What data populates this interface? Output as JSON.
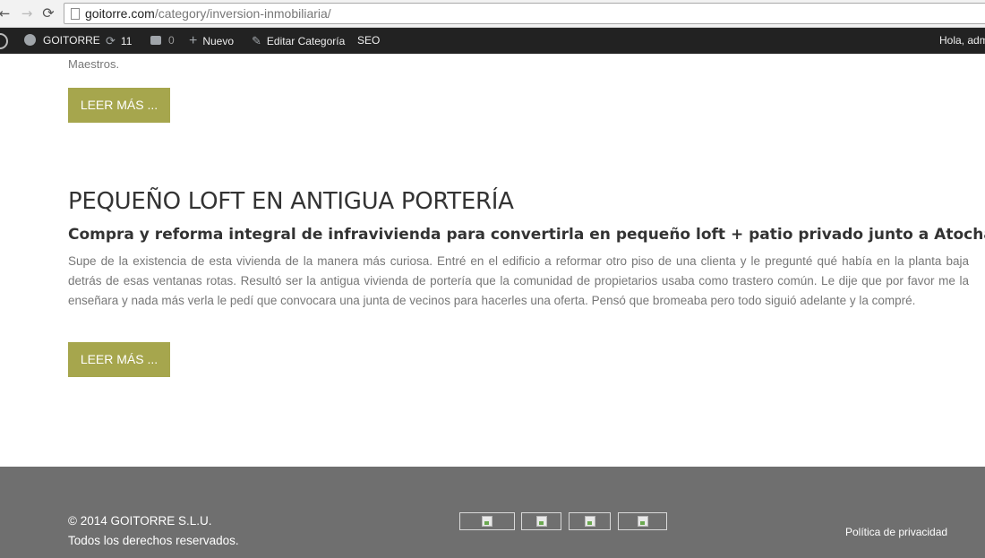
{
  "browser": {
    "url_host": "goitorre.com",
    "url_path": "/category/inversion-inmobiliaria/",
    "back_icon": "←",
    "forward_icon": "→",
    "reload_icon": "⟳"
  },
  "admin_bar": {
    "site_name": "GOITORRE",
    "updates_count": "11",
    "comments_count": "0",
    "new_label": "Nuevo",
    "edit_label": "Editar Categoría",
    "seo_label": "SEO",
    "greeting": "Hola, adm",
    "updates_icon": "⟳",
    "new_icon": "+",
    "edit_icon": "✎"
  },
  "previous_post": {
    "excerpt_tail": "Maestros.",
    "read_more": "LEER MÁS ..."
  },
  "post": {
    "title": "PEQUEÑO LOFT EN ANTIGUA PORTERÍA",
    "subtitle": "Compra y reforma integral de infravivienda para convertirla en pequeño loft + patio privado junto a Atocha",
    "body": "Supe de la existencia de esta vivienda de la manera más curiosa. Entré en el edificio a reformar otro piso de una clienta y le pregunté qué había en la planta baja detrás de esas ventanas rotas. Resultó ser la antigua vivienda de portería que la comunidad de propietarios usaba como trastero común. Le dije que por favor me la enseñara y nada más verla le pedí que convocara una junta de vecinos para hacerles una oferta. Pensó que bromeaba pero todo siguió adelante y la compré.",
    "read_more": "LEER MÁS ..."
  },
  "footer": {
    "copyright": "© 2014 GOITORRE S.L.U.",
    "rights": "Todos los derechos reservados.",
    "privacy": "Política de privacidad"
  },
  "colors": {
    "button": "#a6a64d",
    "admin_bar": "#222222",
    "footer": "#6f6f6f"
  }
}
